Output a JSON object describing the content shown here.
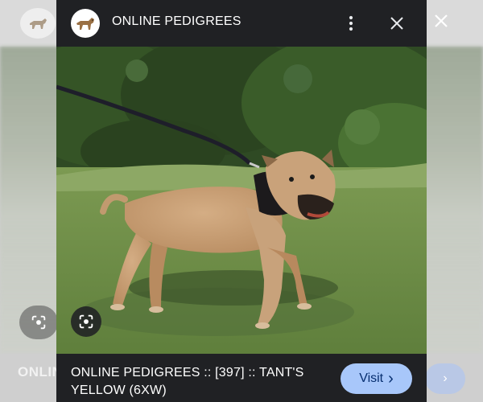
{
  "header": {
    "site_name": "ONLINE PEDIGREES"
  },
  "footer": {
    "caption": "ONLINE PEDIGREES :: [397] :: TANT'S YELLOW (6XW)",
    "visit_label": "Visit",
    "visit_chevron": "›"
  },
  "background": {
    "caption_fragment": "ONLINE PEDIGREES",
    "visit_chevron": "›"
  },
  "icons": {
    "site_logo": "dog-logo-icon",
    "more": "more-vert-icon",
    "close": "close-icon",
    "lens": "lens-icon"
  },
  "colors": {
    "panel": "#202124",
    "visit_button": "#a8c7fa",
    "visit_text": "#062e6f",
    "grass": "#6b8a45",
    "dog_coat": "#c9a177"
  }
}
